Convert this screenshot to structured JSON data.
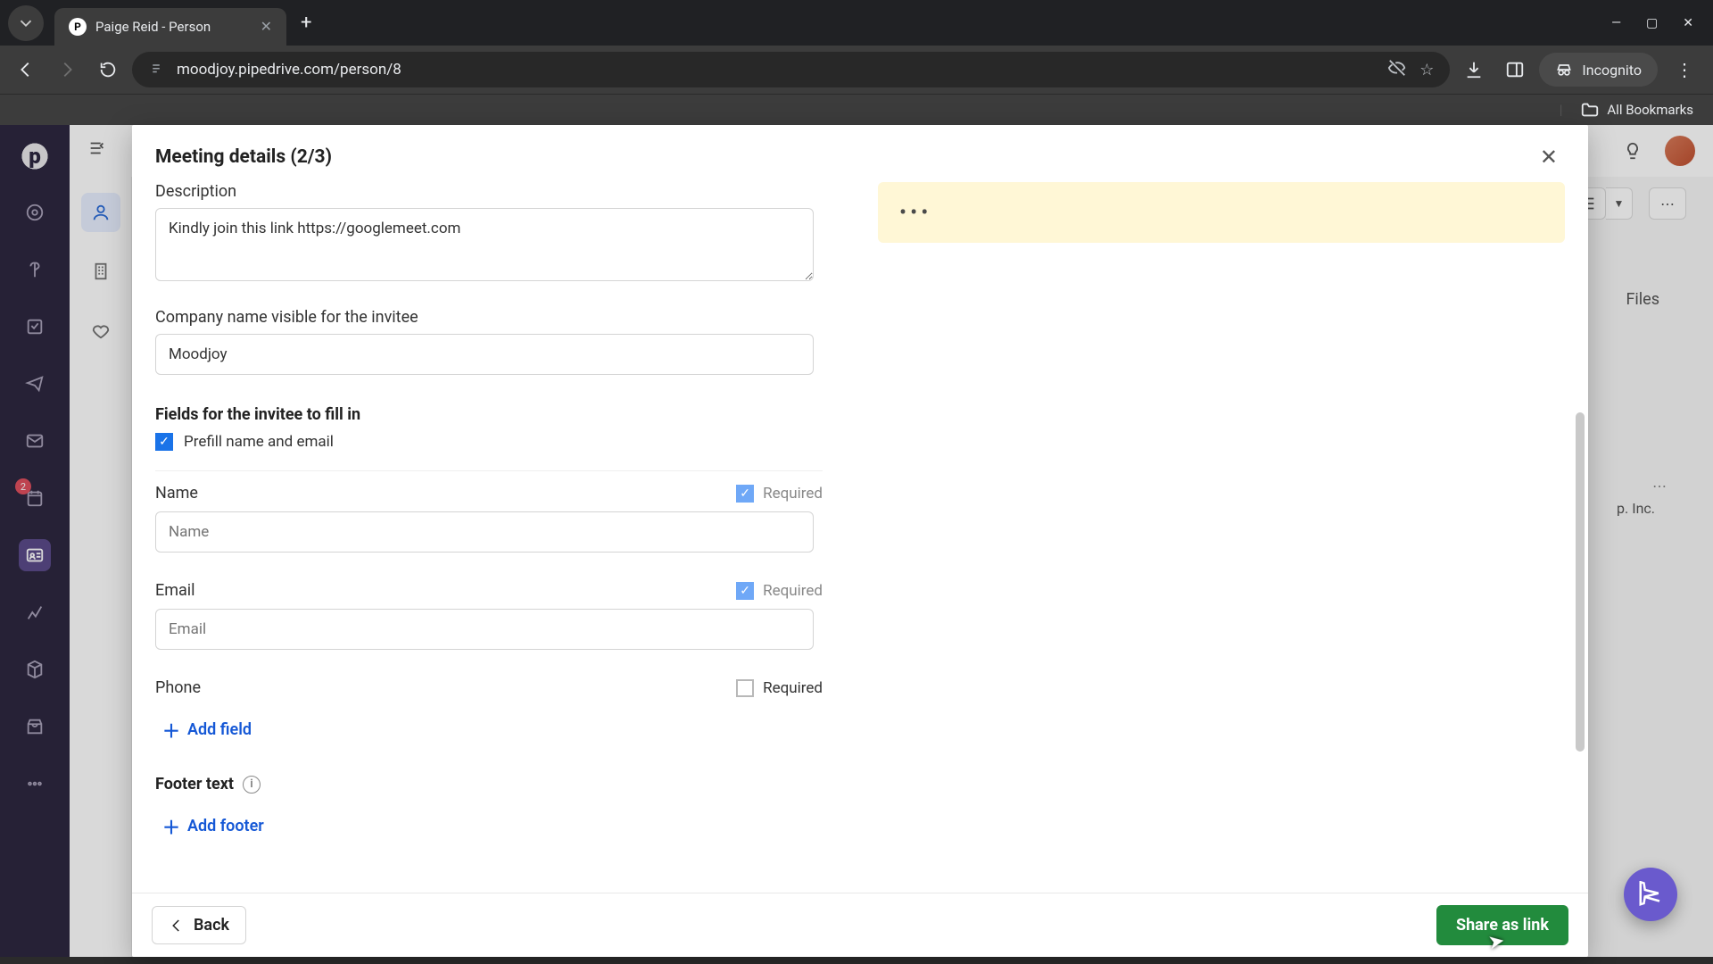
{
  "browser": {
    "tab_title": "Paige Reid - Person",
    "url": "moodjoy.pipedrive.com/person/8",
    "incognito": "Incognito",
    "all_bookmarks": "All Bookmarks"
  },
  "app": {
    "header": {},
    "leftrail_badge": "2",
    "bg": {
      "files_tab": "Files",
      "company_hint": "p. Inc."
    }
  },
  "modal": {
    "title": "Meeting details (2/3)",
    "labels": {
      "description": "Description",
      "company": "Company name visible for the invitee",
      "fields_section": "Fields for the invitee to fill in",
      "prefill": "Prefill name and email",
      "name": "Name",
      "email": "Email",
      "phone": "Phone",
      "required": "Required",
      "add_field": "Add field",
      "footer_section": "Footer text",
      "add_footer": "Add footer"
    },
    "values": {
      "description": "Kindly join this link https://googlemeet.com",
      "company": "Moodjoy",
      "name_placeholder": "Name",
      "email_placeholder": "Email"
    },
    "preview_loading": "•••",
    "footer": {
      "back": "Back",
      "share": "Share as link"
    }
  }
}
